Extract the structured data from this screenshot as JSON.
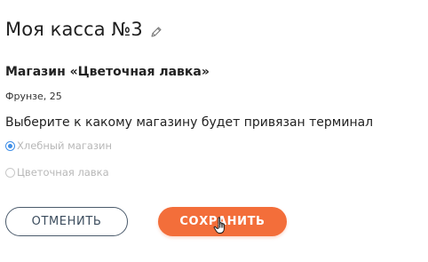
{
  "header": {
    "title": "Моя касса №3",
    "edit_icon": "pencil-icon"
  },
  "store": {
    "name": "Магазин «Цветочная лавка»",
    "address": "Фрунзе, 25"
  },
  "binding": {
    "prompt": "Выберите к какому магазину будет привязан терминал",
    "options": [
      {
        "label": "Хлебный магазин",
        "selected": true
      },
      {
        "label": "Цветочная лавка",
        "selected": false
      }
    ]
  },
  "actions": {
    "cancel_label": "ОТМЕНИТЬ",
    "save_label": "СОХРАНИТЬ"
  },
  "colors": {
    "accent": "#f36e3a",
    "radio_selected": "#3f8fe8",
    "cancel_border": "#4a5a6b"
  }
}
